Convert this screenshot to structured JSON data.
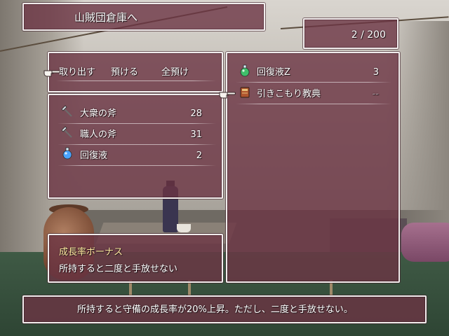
{
  "title": "山賊団倉庫へ",
  "capacity": "2 / 200",
  "commands": [
    "取り出す",
    "預ける",
    "全預け"
  ],
  "party_items": [
    {
      "icon": "axe-icon",
      "name": "大衆の斧",
      "count": "28"
    },
    {
      "icon": "axe-icon",
      "name": "職人の斧",
      "count": "31"
    },
    {
      "icon": "potion-icon",
      "name": "回復液",
      "count": "2"
    }
  ],
  "storage_items": [
    {
      "icon": "potion-icon",
      "name": "回復液Z",
      "count": "3"
    },
    {
      "icon": "book-icon",
      "name": "引きこもり教典",
      "count": "--"
    }
  ],
  "detail": {
    "heading": "成長率ボーナス",
    "text": "所持すると二度と手放せない"
  },
  "help_text": "所持すると守備の成長率が20%上昇。ただし、二度と手放せない。",
  "colors": {
    "window": "#6c3444",
    "border": "#f1ecec",
    "highlight_text": "#ffe9a0"
  }
}
